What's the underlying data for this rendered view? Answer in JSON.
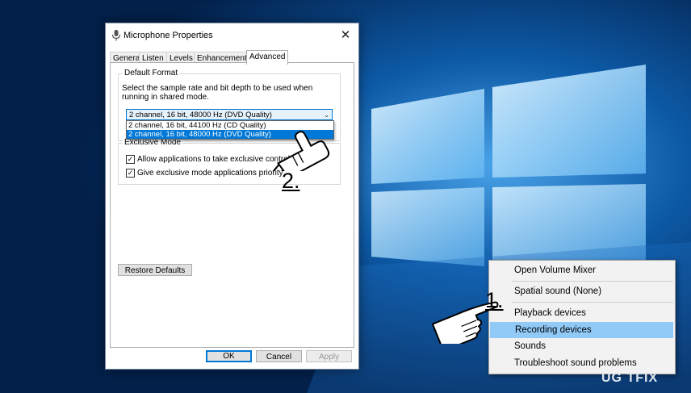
{
  "colors": {
    "accent": "#0078d7",
    "highlight": "#91c9f7",
    "desktop": "#0a3c79"
  },
  "dialog": {
    "title": "Microphone Properties",
    "close_glyph": "✕",
    "tabs": [
      "General",
      "Listen",
      "Levels",
      "Enhancements",
      "Advanced"
    ],
    "active_tab": "Advanced",
    "default_format": {
      "legend": "Default Format",
      "description": "Select the sample rate and bit depth to be used when running in shared mode.",
      "selected_value": "2 channel, 16 bit, 48000 Hz (DVD Quality)",
      "options": [
        "2 channel, 16 bit, 44100 Hz (CD Quality)",
        "2 channel, 16 bit, 48000 Hz (DVD Quality)"
      ]
    },
    "exclusive_mode": {
      "legend": "Exclusive Mode",
      "allow_label": "Allow applications to take exclusive control o",
      "priority_label": "Give exclusive mode applications priority",
      "check_glyph": "✓"
    },
    "restore_defaults": "Restore Defaults",
    "ok": "OK",
    "cancel": "Cancel",
    "apply": "Apply"
  },
  "context_menu": {
    "items": [
      "Open Volume Mixer",
      "Spatial sound (None)",
      "Playback devices",
      "Recording devices",
      "Sounds",
      "Troubleshoot sound problems"
    ],
    "highlighted": "Recording devices"
  },
  "annotations": {
    "step1": "1.",
    "step2": "2."
  },
  "watermark": "UG  TFIX"
}
